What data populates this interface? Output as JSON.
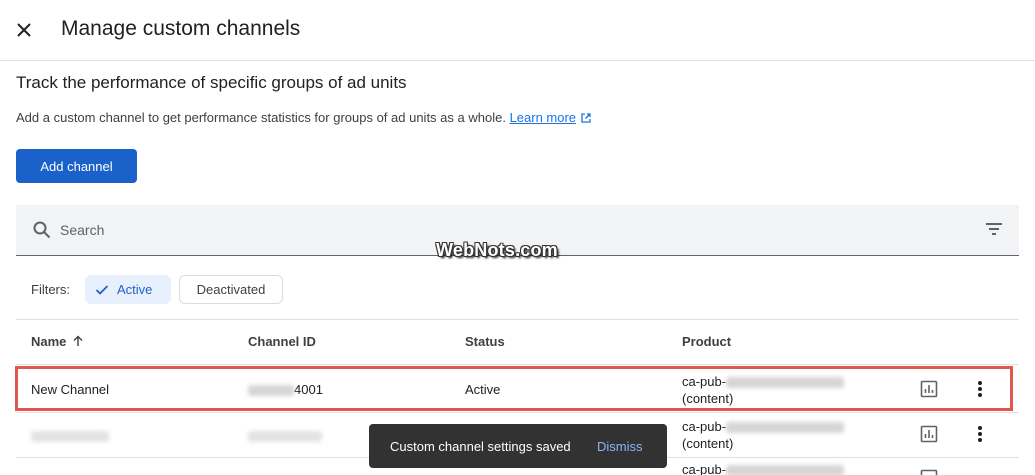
{
  "header": {
    "title": "Manage custom channels"
  },
  "main": {
    "heading": "Track the performance of specific groups of ad units",
    "description": "Add a custom channel to get performance statistics for groups of ad units as a whole.",
    "learn_more": "Learn more",
    "add_button": "Add channel"
  },
  "search": {
    "placeholder": "Search"
  },
  "watermark": "WebNots.com",
  "filters": {
    "label": "Filters:",
    "chips": [
      {
        "label": "Active",
        "selected": true
      },
      {
        "label": "Deactivated",
        "selected": false
      }
    ]
  },
  "table": {
    "headers": [
      "Name",
      "Channel ID",
      "Status",
      "Product"
    ],
    "rows": [
      {
        "name": "New Channel",
        "channel_id_suffix": "4001",
        "status": "Active",
        "product_prefix": "ca-pub-",
        "product_suffix": "(content)"
      },
      {
        "product_prefix": "ca-pub-",
        "product_suffix": "(content)"
      },
      {
        "product_prefix": "ca-pub-"
      }
    ]
  },
  "toast": {
    "message": "Custom channel settings saved",
    "action": "Dismiss"
  },
  "colors": {
    "primary": "#1a62c9",
    "link": "#1a73e8",
    "highlight": "#e2574c",
    "toast_bg": "#323232",
    "toast_action": "#8ab4f8"
  },
  "icons": [
    "close-icon",
    "external-link-icon",
    "search-icon",
    "filter-icon",
    "check-icon",
    "arrow-up-icon",
    "bar-chart-icon",
    "more-vert-icon"
  ]
}
